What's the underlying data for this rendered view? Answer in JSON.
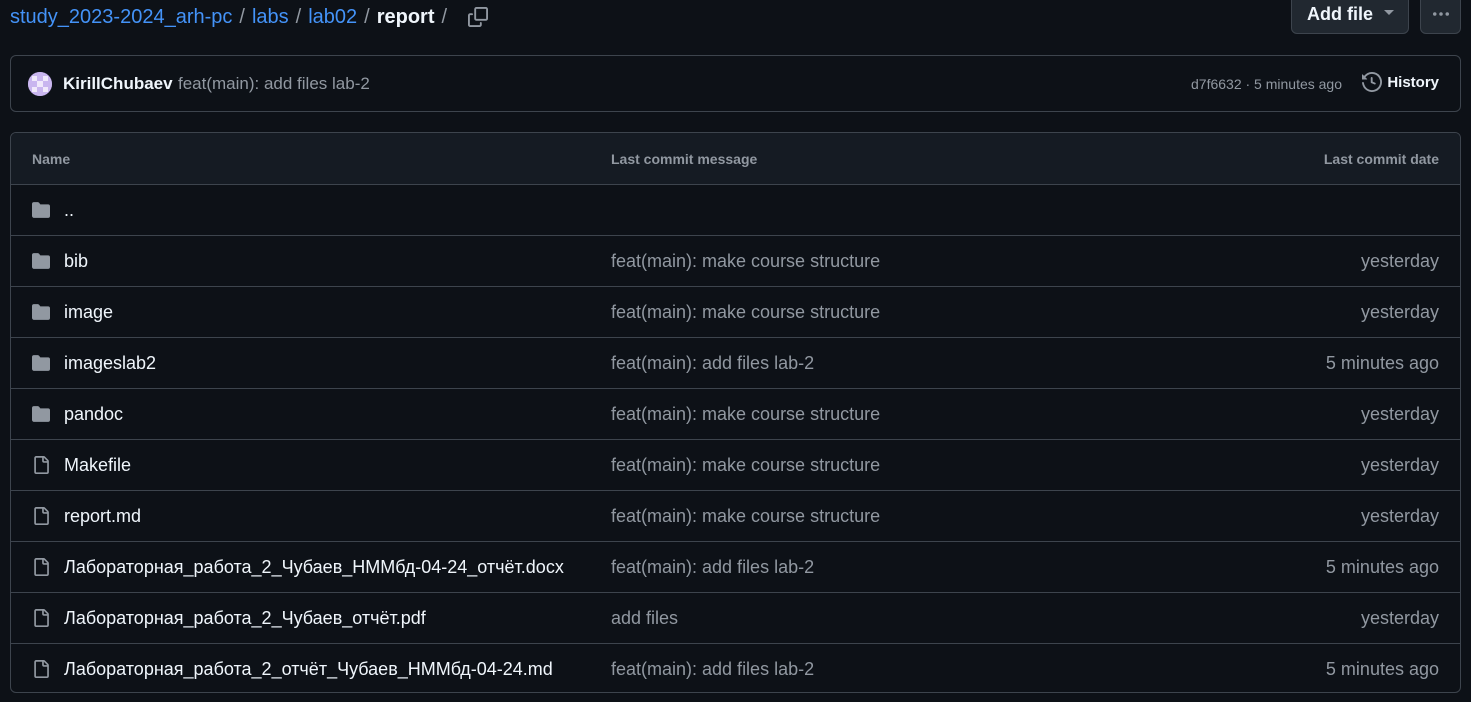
{
  "breadcrumb": {
    "repo": "study_2023-2024_arh-pc",
    "sep": "/",
    "path1": "labs",
    "path2": "lab02",
    "current": "report"
  },
  "header": {
    "add_file_label": "Add file",
    "copy_icon": "copy-icon",
    "more_icon": "kebab-horizontal-icon"
  },
  "commit": {
    "author": "KirillChubaev",
    "message": "feat(main): add files lab-2",
    "meta": "d7f6632 · 5 minutes ago",
    "history_label": "History"
  },
  "table": {
    "columns": {
      "name": "Name",
      "message": "Last commit message",
      "date": "Last commit date"
    },
    "rows": [
      {
        "type": "folder",
        "name": "..",
        "message": "",
        "date": ""
      },
      {
        "type": "folder",
        "name": "bib",
        "message": "feat(main): make course structure",
        "date": "yesterday"
      },
      {
        "type": "folder",
        "name": "image",
        "message": "feat(main): make course structure",
        "date": "yesterday"
      },
      {
        "type": "folder",
        "name": "imageslab2",
        "message": "feat(main): add files lab-2",
        "date": "5 minutes ago"
      },
      {
        "type": "folder",
        "name": "pandoc",
        "message": "feat(main): make course structure",
        "date": "yesterday"
      },
      {
        "type": "file",
        "name": "Makefile",
        "message": "feat(main): make course structure",
        "date": "yesterday"
      },
      {
        "type": "file",
        "name": "report.md",
        "message": "feat(main): make course structure",
        "date": "yesterday"
      },
      {
        "type": "file",
        "name": "Лабораторная_работа_2_Чубаев_НММбд-04-24_отчёт.docx",
        "message": "feat(main): add files lab-2",
        "date": "5 minutes ago"
      },
      {
        "type": "file",
        "name": "Лабораторная_работа_2_Чубаев_отчёт.pdf",
        "message": "add files",
        "date": "yesterday"
      },
      {
        "type": "file",
        "name": "Лабораторная_работа_2_отчёт_Чубаев_НММбд-04-24.md",
        "message": "feat(main): add files lab-2",
        "date": "5 minutes ago"
      }
    ]
  },
  "colors": {
    "background": "#0d1117",
    "link": "#4493f8",
    "muted": "#9198a1",
    "border": "#3d444d"
  }
}
